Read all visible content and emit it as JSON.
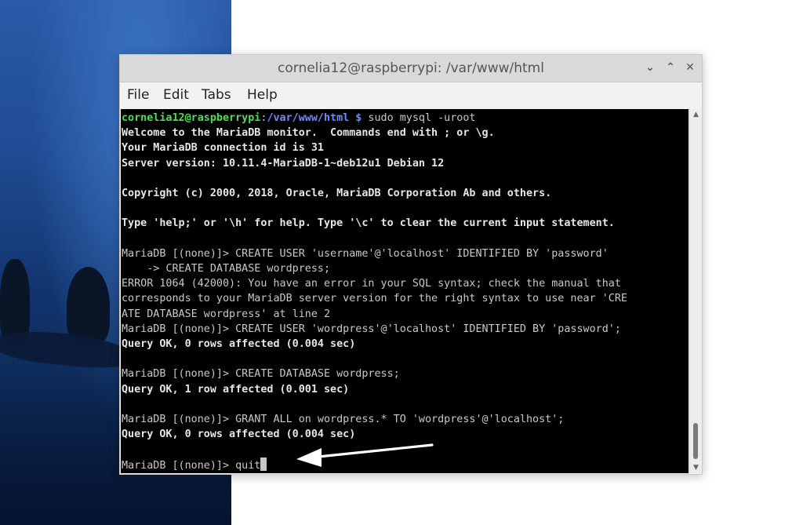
{
  "window": {
    "title": "cornelia12@raspberrypi: /var/www/html",
    "controls": {
      "minimize_icon": "chevron-down-icon",
      "maximize_icon": "chevron-up-icon",
      "close_icon": "close-icon",
      "minimize_glyph": "⌄",
      "maximize_glyph": "⌃",
      "close_glyph": "✕"
    }
  },
  "menu": {
    "file": "File",
    "edit": "Edit",
    "tabs": "Tabs",
    "help": "Help"
  },
  "terminal": {
    "prompt_user": "cornelia12@raspberrypi",
    "prompt_sep": ":",
    "prompt_path": "/var/www/html $",
    "command": " sudo mysql -uroot",
    "lines": {
      "welcome": "Welcome to the MariaDB monitor.  Commands end with ; or \\g.",
      "conn_id": "Your MariaDB connection id is 31",
      "server_version": "Server version: 10.11.4-MariaDB-1~deb12u1 Debian 12",
      "copyright": "Copyright (c) 2000, 2018, Oracle, MariaDB Corporation Ab and others.",
      "help_hint": "Type 'help;' or '\\h' for help. Type '\\c' to clear the current input statement.",
      "cmd1": "MariaDB [(none)]> CREATE USER 'username'@'localhost' IDENTIFIED BY 'password'",
      "cmd1_cont": "    -> CREATE DATABASE wordpress;",
      "error1": "ERROR 1064 (42000): You have an error in your SQL syntax; check the manual that",
      "error2": "corresponds to your MariaDB server version for the right syntax to use near 'CRE",
      "error3": "ATE DATABASE wordpress' at line 2",
      "cmd2": "MariaDB [(none)]> CREATE USER 'wordpress'@'localhost' IDENTIFIED BY 'password';",
      "ok2": "Query OK, 0 rows affected (0.004 sec)",
      "cmd3": "MariaDB [(none)]> CREATE DATABASE wordpress;",
      "ok3": "Query OK, 1 row affected (0.001 sec)",
      "cmd4": "MariaDB [(none)]> GRANT ALL on wordpress.* TO 'wordpress'@'localhost';",
      "ok4": "Query OK, 0 rows affected (0.004 sec)",
      "cmd5": "MariaDB [(none)]> quit"
    }
  },
  "colors": {
    "prompt_user": "#4ce04c",
    "prompt_path": "#6b8cff",
    "terminal_bg": "#000000",
    "annotation_arrow": "#ffffff"
  },
  "annotation": {
    "icon": "arrow-left-icon"
  }
}
